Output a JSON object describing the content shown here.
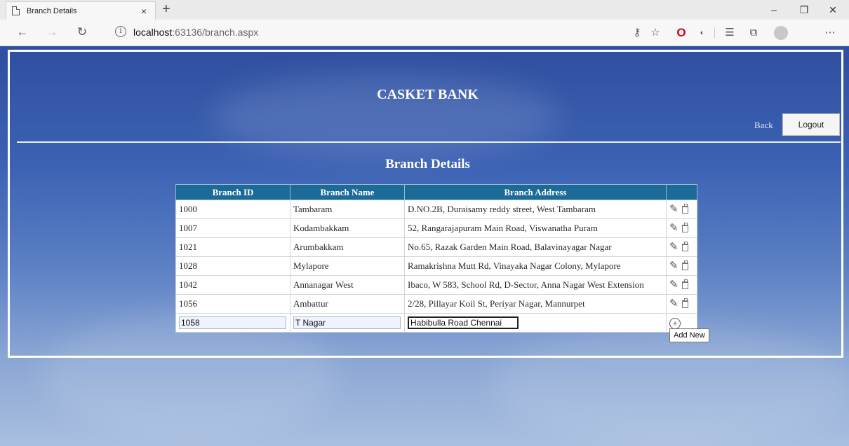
{
  "browser": {
    "tab_title": "Branch Details",
    "tab_close": "×",
    "new_tab": "+",
    "url_host": "localhost",
    "url_rest": ":63136/branch.aspx",
    "window_controls": {
      "minimize": "–",
      "restore": "❐",
      "close": "✕"
    },
    "nav": {
      "back": "←",
      "forward": "→",
      "refresh": "↻"
    },
    "toolbar_icons": [
      "key-icon",
      "favorite-star-icon",
      "opera-icon",
      "extension-icon",
      "favorites-list-icon",
      "collections-icon",
      "profile-icon",
      "more-icon"
    ]
  },
  "page": {
    "site_title": "CASKET BANK",
    "back_link": "Back",
    "logout_button": "Logout",
    "section_title": "Branch Details",
    "table": {
      "headers": [
        "Branch ID",
        "Branch Name",
        "Branch Address",
        ""
      ],
      "rows": [
        {
          "id": "1000",
          "name": "Tambaram",
          "address": "D.NO.2B, Duraisamy reddy street, West Tambaram"
        },
        {
          "id": "1007",
          "name": "Kodambakkam",
          "address": "52, Rangarajapuram Main Road, Viswanatha Puram"
        },
        {
          "id": "1021",
          "name": "Arumbakkam",
          "address": "No.65, Razak Garden Main Road, Balavinayagar Nagar"
        },
        {
          "id": "1028",
          "name": "Mylapore",
          "address": "Ramakrishna Mutt Rd, Vinayaka Nagar Colony, Mylapore"
        },
        {
          "id": "1042",
          "name": "Annanagar West",
          "address": "Ibaco, W 583, School Rd, D-Sector, Anna Nagar West Extension"
        },
        {
          "id": "1056",
          "name": "Ambattur",
          "address": "2/28, Pillayar Koil St, Periyar Nagar, Mannurpet"
        }
      ],
      "new_row": {
        "id": "1058",
        "name": "T Nagar",
        "address": "Habibulla Road Chennai"
      }
    },
    "tooltip": "Add New"
  }
}
